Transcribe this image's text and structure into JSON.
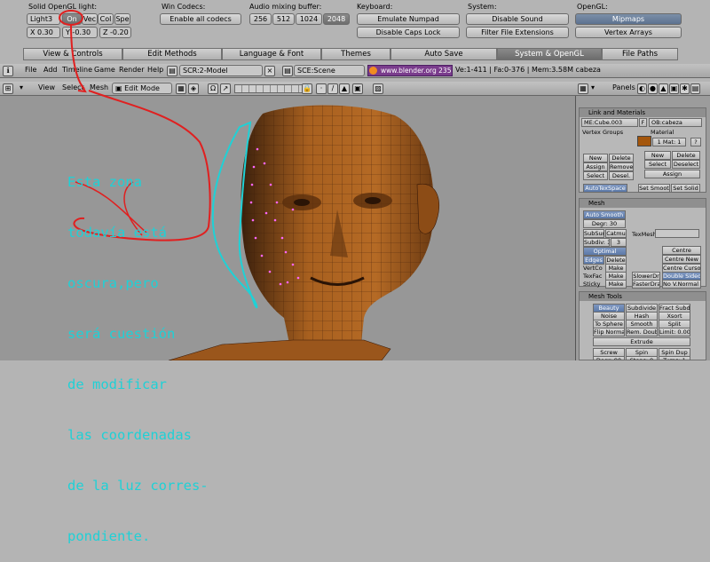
{
  "user_prefs": {
    "opengl_light_label": "Solid OpenGL light:",
    "light_select": "Light3",
    "light_on": "On",
    "light_vec": "Vec",
    "light_col": "Col",
    "light_spe": "Spe",
    "light_x": "X 0.30",
    "light_y": "Y -0.30",
    "light_z": "Z -0.20",
    "win_codecs_label": "Win Codecs:",
    "enable_all_codecs": "Enable all codecs",
    "audio_label": "Audio mixing buffer:",
    "audio_buffers": [
      "256",
      "512",
      "1024",
      "2048"
    ],
    "keyboard_label": "Keyboard:",
    "emulate_numpad": "Emulate Numpad",
    "disable_caps_lock": "Disable Caps Lock",
    "system_label": "System:",
    "disable_sound": "Disable Sound",
    "filter_file_extensions": "Filter File Extensions",
    "opengl_label": "OpenGL:",
    "mipmaps": "Mipmaps",
    "vertex_arrays": "Vertex Arrays"
  },
  "tabs": [
    "View & Controls",
    "Edit Methods",
    "Language & Font",
    "Themes",
    "Auto Save",
    "System & OpenGL",
    "File Paths"
  ],
  "info_header": {
    "menus": [
      "File",
      "Add",
      "Timeline",
      "Game",
      "Render",
      "Help"
    ],
    "screen": "SCR:2-Model",
    "scene": "SCE:Scene",
    "url": "www.blender.org 235",
    "stats": "Ve:1-411 | Fa:0-376 | Mem:3.58M cabeza"
  },
  "view3d_header": {
    "menus": [
      "View",
      "Select",
      "Mesh"
    ],
    "mode": "Edit Mode"
  },
  "annotation": {
    "lines": [
      "Esta zona",
      "todavía está",
      "oscura,pero",
      "será cuestión",
      "de modificar",
      "las coordenadas",
      "de la luz corres-",
      "pondiente."
    ]
  },
  "buttons_window": {
    "panels_label": "Panels",
    "link_materials": {
      "title": "Link and Materials",
      "mesh_name": "ME:Cube.003",
      "f_label": "F",
      "object_name": "OB:cabeza",
      "vertex_groups": "Vertex Groups",
      "material": "Material",
      "mat_count": "1 Mat: 1",
      "mat_help": "?",
      "vg_buttons": [
        "New",
        "Delete",
        "Assign",
        "Remove",
        "Select",
        "Desel."
      ],
      "mat_buttons": [
        "New",
        "Delete",
        "Select",
        "Deselect",
        "Assign"
      ],
      "autotexspace": "AutoTexSpace",
      "set_smooth": "Set Smoot",
      "set_solid": "Set Solid"
    },
    "mesh": {
      "title": "Mesh",
      "auto_smooth": "Auto Smooth",
      "degr": "Degr: 30",
      "subsurf": "SubSurf",
      "catmull": "Catmu",
      "texmesh": "TexMesh:",
      "subdiv": "Subdiv: 1",
      "subdiv_render": "3",
      "optimal": "Optimal",
      "centre": "Centre",
      "centre_new": "Centre New",
      "centre_cursor": "Centre Cursor",
      "edges": "Edges",
      "delete": "Delete",
      "vertco": "VertCo",
      "make1": "Make",
      "texfac": "TexFac",
      "make2": "Make",
      "slower_draw": "SlowerDr",
      "double_sided": "Double Sided",
      "sticky": "Sticky",
      "make3": "Make",
      "faster_draw": "FasterDra",
      "no_v_normal": "No V.Normal F"
    },
    "mesh_tools": {
      "title": "Mesh Tools",
      "row1": [
        "Beauty",
        "Subdivide",
        "Fract Subd"
      ],
      "row2": [
        "Noise",
        "Hash",
        "Xsort"
      ],
      "row3": [
        "To Sphere",
        "Smooth",
        "Split"
      ],
      "row4": [
        "Flip Normal",
        "Rem. Double",
        "Limit: 0.001"
      ],
      "extrude": "Extrude",
      "screw": "Screw",
      "spin": "Spin",
      "spin_dup": "Spin Dup",
      "degr": "Degr: 90",
      "steps": "Steps: 9",
      "turns": "Turns: 1"
    }
  },
  "colors": {
    "annotation_cyan": "#1fd1d6",
    "annotation_red": "#e02020",
    "mesh_brown": "#a65a1e",
    "material_swatch": "#a4560c"
  }
}
